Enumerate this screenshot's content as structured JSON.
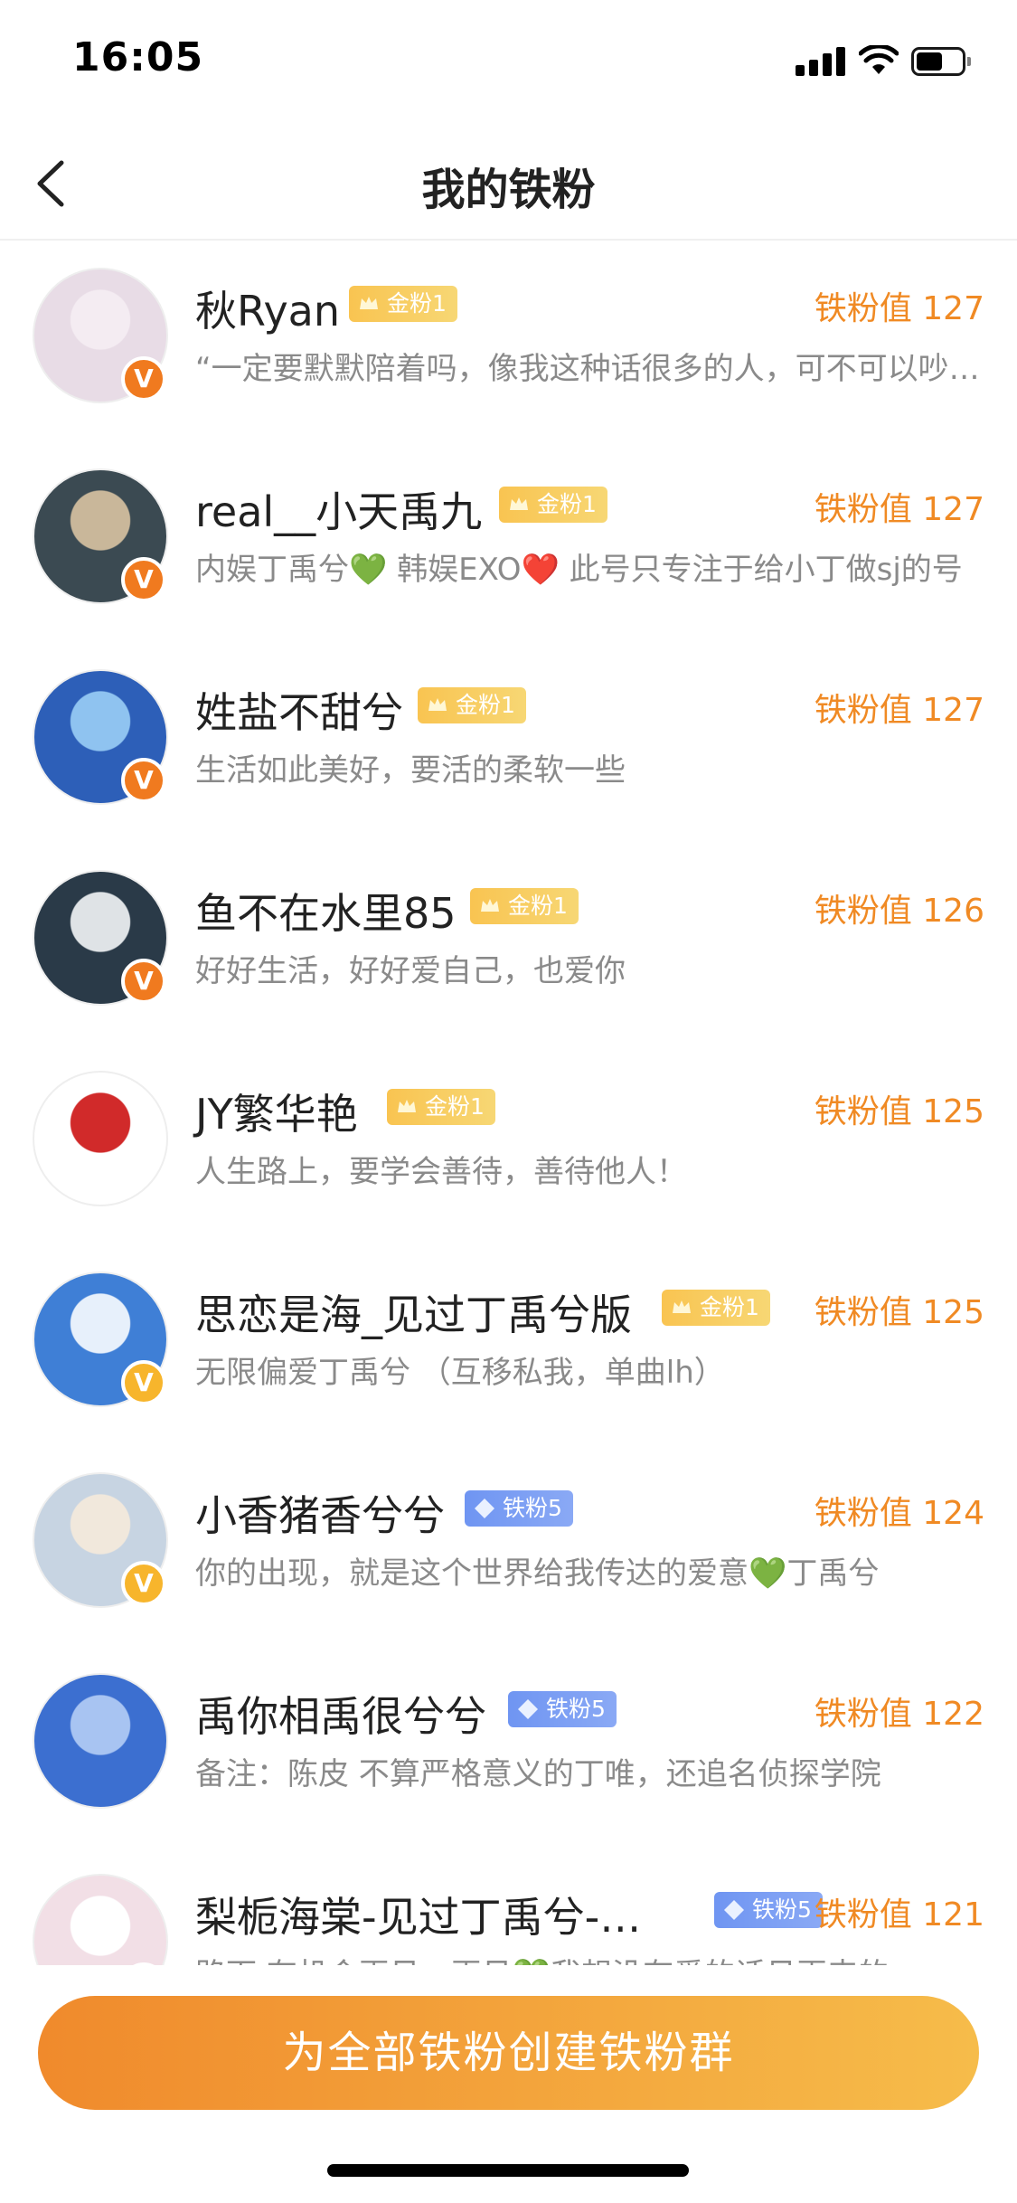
{
  "status_bar": {
    "time": "16:05"
  },
  "nav": {
    "title": "我的铁粉"
  },
  "fans": [
    {
      "name": "秋Ryan",
      "level": "金粉1",
      "level_type": "gold",
      "score": "铁粉值 127",
      "desc": "“一定要默默陪着吗，像我这种话很多的人，可不可以吵吵闹闹陪着你”",
      "badge": "orange",
      "avatar_colors": [
        "#e8dce6",
        "#f4ecf2"
      ]
    },
    {
      "name": "real__小天禹九",
      "level": "金粉1",
      "level_type": "gold",
      "score": "铁粉值 127",
      "desc": "内娱丁禹兮💚 韩娱EXO❤️ 此号只专注于给小丁做sj的号",
      "badge": "orange",
      "avatar_colors": [
        "#3b4a52",
        "#c9b79a"
      ]
    },
    {
      "name": "姓盐不甜兮",
      "level": "金粉1",
      "level_type": "gold",
      "score": "铁粉值 127",
      "desc": "生活如此美好，要活的柔软一些",
      "badge": "orange",
      "avatar_colors": [
        "#2d5fb8",
        "#8fc3f0"
      ]
    },
    {
      "name": "鱼不在水里85",
      "level": "金粉1",
      "level_type": "gold",
      "score": "铁粉值 126",
      "desc": "好好生活，好好爱自己，也爱你",
      "badge": "orange",
      "avatar_colors": [
        "#2a3a48",
        "#dfe3e6"
      ]
    },
    {
      "name": "JY繁华艳",
      "level": "金粉1",
      "level_type": "gold",
      "score": "铁粉值 125",
      "desc": "人生路上，要学会善待，善待他人！",
      "badge": "",
      "avatar_colors": [
        "#ffffff",
        "#d12a2a"
      ]
    },
    {
      "name": "思恋是海_见过丁禹兮版",
      "level": "金粉1",
      "level_type": "gold",
      "score": "铁粉值 125",
      "desc": "无限偏爱丁禹兮 （互移私我，单曲lh）",
      "badge": "yellow",
      "avatar_colors": [
        "#3f7fd6",
        "#e7f0fb"
      ]
    },
    {
      "name": "小香猪香兮兮",
      "level": "铁粉5",
      "level_type": "iron",
      "score": "铁粉值 124",
      "desc": "你的出现，就是这个世界给我传达的爱意💚丁禹兮",
      "badge": "yellow",
      "avatar_colors": [
        "#c7d4e2",
        "#f1e8dc"
      ]
    },
    {
      "name": "禹你相禹很兮兮",
      "level": "铁粉5",
      "level_type": "iron",
      "score": "铁粉值 122",
      "desc": "备注：陈皮 不算严格意义的丁唯，还追名侦探学院",
      "badge": "",
      "avatar_colors": [
        "#3c6fd0",
        "#a8c4f2"
      ]
    },
    {
      "name": "梨栀海棠-见过丁禹兮-…",
      "level": "铁粉5",
      "level_type": "iron",
      "score": "铁粉值 121",
      "desc": "路下 有机会再见，再见💚我想没有爱的话见再来的",
      "badge": "yellow",
      "avatar_colors": [
        "#f2dfe6",
        "#ffffff"
      ]
    }
  ],
  "bottom": {
    "create_group_label": "为全部铁粉创建铁粉群"
  },
  "colors": {
    "accent": "#f08a24",
    "gold_badge": "#f9c451",
    "iron_badge": "#6f95f2",
    "button_start": "#f08a2c",
    "button_end": "#f6bc4a"
  }
}
